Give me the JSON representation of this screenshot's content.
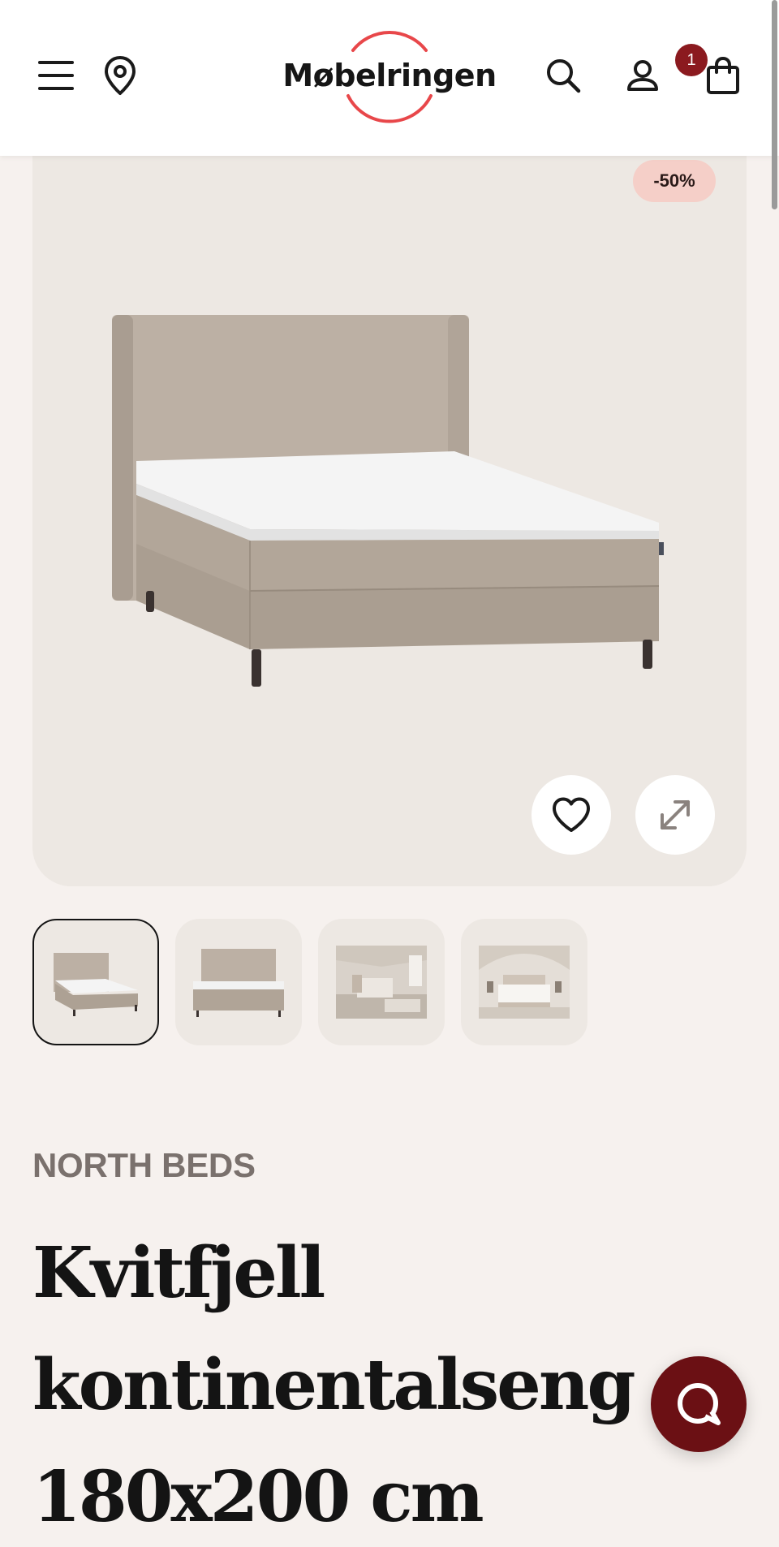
{
  "header": {
    "logo_text": "Møbelringen",
    "cart_count": "1"
  },
  "product": {
    "discount": "-50%",
    "brand": "NORTH BEDS",
    "title": "Kvitfjell kontinentalseng 180x200 cm"
  },
  "icons": {
    "menu": "menu-icon",
    "location": "location-pin-icon",
    "search": "search-icon",
    "account": "user-icon",
    "cart": "shopping-bag-icon",
    "favorite": "heart-icon",
    "fullscreen": "expand-icon",
    "chat": "chat-icon"
  },
  "thumbnails": [
    {
      "alt": "Bed front angle",
      "active": true
    },
    {
      "alt": "Bed front view",
      "active": false
    },
    {
      "alt": "Bed in bedroom",
      "active": false
    },
    {
      "alt": "Bed in attic bedroom",
      "active": false
    }
  ],
  "colors": {
    "brand_red": "#e8474a",
    "badge_bg": "#f5cfc8",
    "chat_bg": "#6b1014",
    "page_bg": "#f6f1ee",
    "card_bg": "#ede8e3"
  }
}
